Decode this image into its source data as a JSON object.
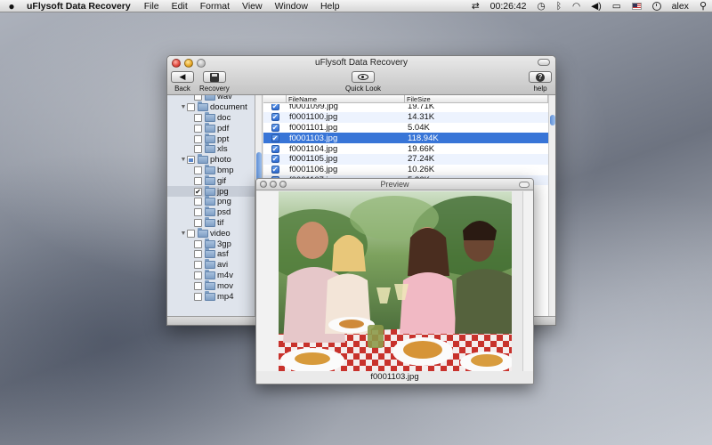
{
  "menubar": {
    "apple": "",
    "app_name": "uFlysoft Data Recovery",
    "items": [
      "File",
      "Edit",
      "Format",
      "View",
      "Window",
      "Help"
    ],
    "timer": "00:26:42",
    "user": "alex"
  },
  "window": {
    "title": "uFlysoft Data Recovery",
    "toolbar": {
      "back": "Back",
      "recovery": "Recovery",
      "quick_look": "Quick Look",
      "help": "help"
    }
  },
  "tree": [
    {
      "label": "wav",
      "level": 2,
      "checked": false,
      "expanded": null
    },
    {
      "label": "document",
      "level": 1,
      "checked": false,
      "expanded": true
    },
    {
      "label": "doc",
      "level": 2,
      "checked": false,
      "expanded": null
    },
    {
      "label": "pdf",
      "level": 2,
      "checked": false,
      "expanded": null
    },
    {
      "label": "ppt",
      "level": 2,
      "checked": false,
      "expanded": null
    },
    {
      "label": "xls",
      "level": 2,
      "checked": false,
      "expanded": null
    },
    {
      "label": "photo",
      "level": 1,
      "checked": "mixed",
      "expanded": true
    },
    {
      "label": "bmp",
      "level": 2,
      "checked": false,
      "expanded": null
    },
    {
      "label": "gif",
      "level": 2,
      "checked": false,
      "expanded": null
    },
    {
      "label": "jpg",
      "level": 2,
      "checked": true,
      "expanded": null,
      "selected": true
    },
    {
      "label": "png",
      "level": 2,
      "checked": false,
      "expanded": null
    },
    {
      "label": "psd",
      "level": 2,
      "checked": false,
      "expanded": null
    },
    {
      "label": "tif",
      "level": 2,
      "checked": false,
      "expanded": null
    },
    {
      "label": "video",
      "level": 1,
      "checked": false,
      "expanded": true
    },
    {
      "label": "3gp",
      "level": 2,
      "checked": false,
      "expanded": null
    },
    {
      "label": "asf",
      "level": 2,
      "checked": false,
      "expanded": null
    },
    {
      "label": "avi",
      "level": 2,
      "checked": false,
      "expanded": null
    },
    {
      "label": "m4v",
      "level": 2,
      "checked": false,
      "expanded": null
    },
    {
      "label": "mov",
      "level": 2,
      "checked": false,
      "expanded": null
    },
    {
      "label": "mp4",
      "level": 2,
      "checked": false,
      "expanded": null
    }
  ],
  "table": {
    "columns": [
      "FileName",
      "FileSize"
    ],
    "rows": [
      {
        "name": "f0001099.jpg",
        "size": "19.71K",
        "selected": false
      },
      {
        "name": "f0001100.jpg",
        "size": "14.31K",
        "selected": false
      },
      {
        "name": "f0001101.jpg",
        "size": "5.04K",
        "selected": false
      },
      {
        "name": "f0001103.jpg",
        "size": "118.94K",
        "selected": true
      },
      {
        "name": "f0001104.jpg",
        "size": "19.66K",
        "selected": false
      },
      {
        "name": "f0001105.jpg",
        "size": "27.24K",
        "selected": false
      },
      {
        "name": "f0001106.jpg",
        "size": "10.26K",
        "selected": false
      },
      {
        "name": "f0001107.jpg",
        "size": "5.26K",
        "selected": false
      }
    ]
  },
  "preview": {
    "title": "Preview",
    "caption": "f0001103.jpg"
  }
}
